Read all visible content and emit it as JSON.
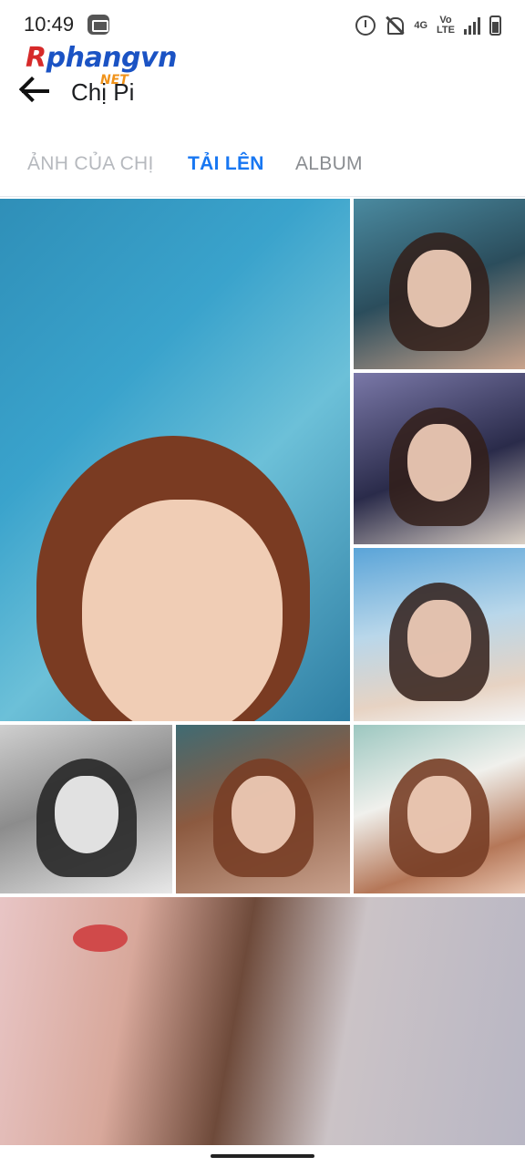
{
  "status_bar": {
    "time": "10:49",
    "network_top": "4G",
    "network_volte": "Vo",
    "network_lte": "LTE",
    "icons": [
      "app-notification-icon",
      "alarm-icon",
      "bell-off-icon",
      "signal-icon",
      "battery-icon"
    ]
  },
  "watermark": {
    "main_red": "R",
    "main_blue": "phangvn",
    "sub": "NET"
  },
  "app_bar": {
    "back_icon": "arrow-left-icon",
    "title": "Chị Pi"
  },
  "tabs": [
    {
      "label": "ẢNH CỦA CHỊ",
      "active": false
    },
    {
      "label": "TẢI LÊN",
      "active": true
    },
    {
      "label": "ALBUM",
      "active": false
    }
  ],
  "photos": [
    "photo-1",
    "photo-2",
    "photo-3",
    "photo-4",
    "photo-5",
    "photo-6",
    "photo-7",
    "photo-8"
  ],
  "colors": {
    "accent": "#1877f2",
    "watermark_red": "#d62a2a",
    "watermark_blue": "#1b53c4",
    "watermark_orange": "#f0931b"
  }
}
